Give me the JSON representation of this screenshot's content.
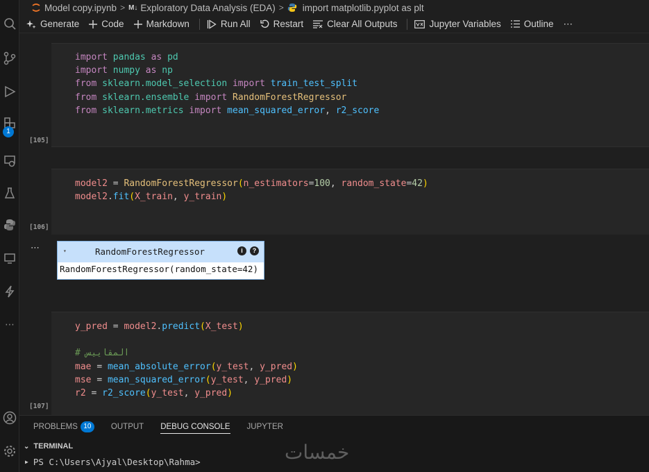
{
  "breadcrumb": {
    "file": "Model copy.ipynb",
    "section_tag": "M↓",
    "section": "Exploratory Data Analysis (EDA)",
    "cell": "import matplotlib.pyplot as plt"
  },
  "toolbar": {
    "generate": "Generate",
    "code": "Code",
    "markdown": "Markdown",
    "run_all": "Run All",
    "restart": "Restart",
    "clear_outputs": "Clear All Outputs",
    "jupyter_variables": "Jupyter Variables",
    "outline": "Outline",
    "more": "⋯"
  },
  "activity_bar": {
    "icons": [
      "search-icon",
      "source-control-icon",
      "run-debug-icon",
      "extensions-icon",
      "remote-explorer-icon",
      "testing-icon",
      "python-icon",
      "monitor-icon",
      "lightning-icon",
      "more-icon",
      "account-icon",
      "settings-icon"
    ],
    "extensions_badge": "1"
  },
  "cells": [
    {
      "exec_count": "[105]",
      "lines": [
        "import pandas as pd",
        "import numpy as np",
        "from sklearn.model_selection import train_test_split",
        "from sklearn.ensemble import RandomForestRegressor",
        "from sklearn.metrics import mean_squared_error, r2_score"
      ]
    },
    {
      "exec_count": "[106]",
      "lines": [
        "model2 = RandomForestRegressor(n_estimators=100, random_state=42)",
        "model2.fit(X_train, y_train)"
      ]
    },
    {
      "exec_count": "[107]",
      "lines": [
        "y_pred = model2.predict(X_test)",
        "",
        "# المقاييس",
        "mae = mean_absolute_error(y_test, y_pred)",
        "mse = mean_squared_error(y_test, y_pred)",
        "r2 = r2_score(y_test, y_pred)"
      ]
    }
  ],
  "output": {
    "more": "⋯",
    "widget_caret": "▾",
    "widget_title": "RandomForestRegressor",
    "info_badge": "i",
    "help_badge": "?",
    "widget_body": "RandomForestRegressor(random_state=42)"
  },
  "panel": {
    "tabs": [
      "PROBLEMS",
      "OUTPUT",
      "DEBUG CONSOLE",
      "JUPYTER"
    ],
    "problems_count": "10",
    "active_tab": "DEBUG CONSOLE",
    "terminal_label": "TERMINAL",
    "terminal_prompt": "PS C:\\Users\\Ajyal\\Desktop\\Rahma>",
    "watermark": "خمسات"
  }
}
